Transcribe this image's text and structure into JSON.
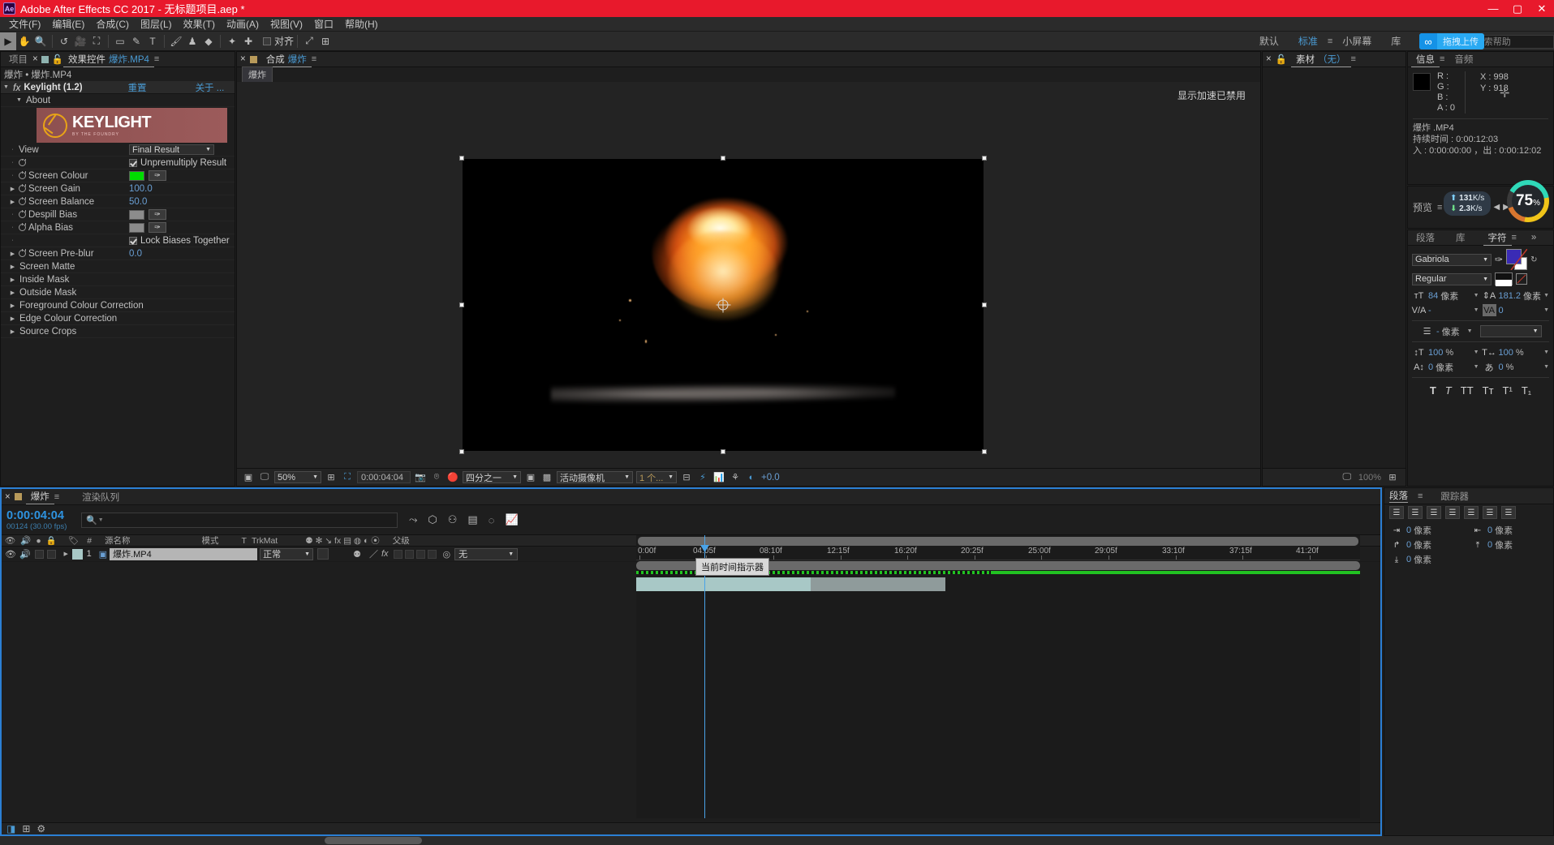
{
  "titlebar": {
    "logo": "Ae",
    "title": "Adobe After Effects CC 2017 - 无标题项目.aep *",
    "minimize": "—",
    "maximize": "▢",
    "close": "✕"
  },
  "menubar": {
    "items": [
      {
        "label": "文件(F)"
      },
      {
        "label": "编辑(E)"
      },
      {
        "label": "合成(C)"
      },
      {
        "label": "图层(L)"
      },
      {
        "label": "效果(T)"
      },
      {
        "label": "动画(A)"
      },
      {
        "label": "视图(V)"
      },
      {
        "label": "窗口"
      },
      {
        "label": "帮助(H)"
      }
    ]
  },
  "toolbar": {
    "tools": [
      {
        "name": "selection-tool",
        "glyph": "▶",
        "active": true
      },
      {
        "name": "hand-tool",
        "glyph": "✋"
      },
      {
        "name": "zoom-tool",
        "glyph": "🔍"
      },
      {
        "name": "rotation-tool",
        "glyph": "↺"
      },
      {
        "name": "camera-tool",
        "glyph": "🎥"
      },
      {
        "name": "pan-behind-tool",
        "glyph": "⛶"
      },
      {
        "name": "shape-tool",
        "glyph": "▭"
      },
      {
        "name": "pen-tool",
        "glyph": "✎"
      },
      {
        "name": "type-tool",
        "glyph": "T"
      },
      {
        "name": "brush-tool",
        "glyph": "🖌"
      },
      {
        "name": "clone-stamp-tool",
        "glyph": "♟"
      },
      {
        "name": "eraser-tool",
        "glyph": "◆"
      },
      {
        "name": "roto-brush-tool",
        "glyph": "✦"
      },
      {
        "name": "puppet-tool",
        "glyph": "✚"
      }
    ],
    "snap_label": "对齐",
    "snap_checked": false,
    "extra": [
      {
        "name": "graph-tool",
        "glyph": "⤢"
      },
      {
        "name": "grid-tool",
        "glyph": "⊞"
      }
    ]
  },
  "workspace": {
    "items": [
      {
        "label": "默认",
        "selected": false
      },
      {
        "label": "标准",
        "selected": true
      },
      {
        "label": "小屏幕",
        "selected": false
      },
      {
        "label": "库",
        "selected": false
      }
    ],
    "overflow": "»",
    "search_placeholder": "搜索帮助",
    "upload_badge": "拖拽上传"
  },
  "effects_panel": {
    "tabs": [
      {
        "label": "项目",
        "selected": false
      },
      {
        "label": "效果控件",
        "value": "爆炸.MP4",
        "selected": true
      }
    ],
    "breadcrumb": "爆炸 • 爆炸.MP4",
    "effect_name": "Keylight (1.2)",
    "reset_label": "重置",
    "about_link": "关于 ...",
    "about_section": "About",
    "keylight_brand": "KEYLIGHT",
    "keylight_sub": "BY THE FOUNDRY",
    "rows": [
      {
        "label": "View",
        "type": "select",
        "value": "Final Result"
      },
      {
        "label": "",
        "type": "checkbox",
        "value": "Unpremultiply Result",
        "checked": true
      },
      {
        "label": "Screen Colour",
        "type": "color",
        "color": "#00dd00"
      },
      {
        "label": "Screen Gain",
        "type": "number",
        "value": "100.0"
      },
      {
        "label": "Screen Balance",
        "type": "number",
        "value": "50.0"
      },
      {
        "label": "Despill Bias",
        "type": "color",
        "color": "#8c8c8c"
      },
      {
        "label": "Alpha Bias",
        "type": "color",
        "color": "#8c8c8c"
      },
      {
        "label": "",
        "type": "checkbox",
        "value": "Lock Biases Together",
        "checked": true
      },
      {
        "label": "Screen Pre-blur",
        "type": "number",
        "value": "0.0"
      }
    ],
    "sections": [
      {
        "label": "Screen Matte"
      },
      {
        "label": "Inside Mask"
      },
      {
        "label": "Outside Mask"
      },
      {
        "label": "Foreground Colour Correction"
      },
      {
        "label": "Edge Colour Correction"
      },
      {
        "label": "Source Crops"
      }
    ]
  },
  "comp_panel": {
    "tabs": [
      {
        "label": "合成",
        "value": "爆炸",
        "selected": true
      }
    ],
    "breadcrumb_chip": "爆炸",
    "gpu_warning": "显示加速已禁用",
    "bottom_bar": {
      "zoom": "50%",
      "timecode": "0:00:04:04",
      "resolution": "四分之一",
      "camera": "活动摄像机",
      "views": "1 个...",
      "exposure": "+0.0"
    }
  },
  "footage_panel": {
    "tabs": [
      {
        "label": "素材",
        "value": "（无）",
        "selected": true
      }
    ],
    "zoom_readout": "100%"
  },
  "info_panel": {
    "tabs": [
      {
        "label": "信息",
        "selected": true
      },
      {
        "label": "音频",
        "selected": false
      }
    ],
    "channels": [
      {
        "key": "R :",
        "value": ""
      },
      {
        "key": "G :",
        "value": ""
      },
      {
        "key": "B :",
        "value": ""
      },
      {
        "key": "A :",
        "value": "0"
      }
    ],
    "coords": {
      "x_label": "X :",
      "x": "998",
      "y_label": "Y :",
      "y": "918"
    },
    "file_name": "爆炸 .MP4",
    "duration": "持续时间 : 0:00:12:03",
    "inout": "入 : 0:00:00:00 ，出 : 0:00:12:02"
  },
  "preview_panel": {
    "label": "预览",
    "network": {
      "up": "131",
      "up_unit": "K/s",
      "down": "2.3",
      "down_unit": "K/s"
    },
    "progress": "75",
    "progress_unit": "%",
    "controls": [
      "⏮",
      "◀",
      "▶",
      "⏭"
    ]
  },
  "character_panel": {
    "tabs": [
      {
        "label": "段落",
        "selected": false
      },
      {
        "label": "库",
        "selected": false
      },
      {
        "label": "字符",
        "selected": true
      }
    ],
    "overflow": "»",
    "font_family": "Gabriola",
    "font_style": "Regular",
    "metrics": [
      {
        "icon": "font-size-icon",
        "glyph": "T",
        "value": "84",
        "unit": "像素"
      },
      {
        "icon": "leading-icon",
        "glyph": "A",
        "value": "181.2",
        "unit": "像素"
      },
      {
        "icon": "kerning-icon",
        "glyph": "V/A",
        "value": "-",
        "unit": ""
      },
      {
        "icon": "tracking-icon",
        "glyph": "VA",
        "value": "0",
        "unit": ""
      },
      {
        "icon": "stroke-width-icon",
        "glyph": "☰",
        "value": "-",
        "unit": "像素"
      }
    ],
    "scale": [
      {
        "icon": "vertical-scale-icon",
        "glyph": "↕T",
        "value": "100",
        "unit": "%"
      },
      {
        "icon": "horizontal-scale-icon",
        "glyph": "T↔",
        "value": "100",
        "unit": "%"
      },
      {
        "icon": "baseline-shift-icon",
        "glyph": "Aa",
        "value": "0",
        "unit": "像素"
      },
      {
        "icon": "tsume-icon",
        "glyph": "あ",
        "value": "0",
        "unit": "%"
      }
    ],
    "styles": [
      "T",
      "T",
      "TT",
      "Tт",
      "T¹",
      "T₁"
    ],
    "fill_color": "#3a2bb5",
    "stroke_color": "#ffffff"
  },
  "timeline": {
    "tabs": [
      {
        "label": "爆炸",
        "selected": true
      },
      {
        "label": "渲染队列",
        "selected": false
      }
    ],
    "current_time": "0:00:04:04",
    "frame_info": "00124 (30.00 fps)",
    "search_placeholder": "",
    "columns": [
      {
        "label": "#"
      },
      {
        "label": "源名称"
      },
      {
        "label": "模式"
      },
      {
        "label": "T"
      },
      {
        "label": "TrkMat"
      },
      {
        "label": "父级"
      }
    ],
    "layers": [
      {
        "index": "1",
        "name": "爆炸.MP4",
        "mode": "正常",
        "trkmat": "",
        "parent": "无",
        "color": "#a8c8c6"
      }
    ],
    "ruler_marks": [
      "0:00f",
      "04:05f",
      "08:10f",
      "12:15f",
      "16:20f",
      "20:25f",
      "25:00f",
      "29:05f",
      "33:10f",
      "37:15f",
      "41:20f"
    ],
    "cti_tooltip": "当前时间指示器"
  },
  "align_panel": {
    "tabs": [
      {
        "label": "段落",
        "selected": true
      },
      {
        "label": "跟踪器",
        "selected": false
      }
    ],
    "align_rows": [
      [
        "align-left-icon",
        "align-center-h-icon",
        "align-right-icon",
        "justify-last-left-icon",
        "justify-last-center-icon",
        "justify-last-right-icon",
        "justify-all-icon"
      ]
    ],
    "indent_values": [
      {
        "icon": "indent-left-icon",
        "value": "0",
        "unit": "像素"
      },
      {
        "icon": "indent-right-icon",
        "value": "0",
        "unit": "像素"
      },
      {
        "icon": "indent-first-icon",
        "value": "0",
        "unit": "像素"
      },
      {
        "icon": "space-before-icon",
        "value": "0",
        "unit": "像素"
      },
      {
        "icon": "space-after-icon",
        "value": "0",
        "unit": "像素"
      }
    ]
  },
  "colors": {
    "accent_red": "#e8192c",
    "accent_blue": "#4a9bd4",
    "panel_bg": "#1e1e1e",
    "screen_colour": "#00dd00"
  }
}
